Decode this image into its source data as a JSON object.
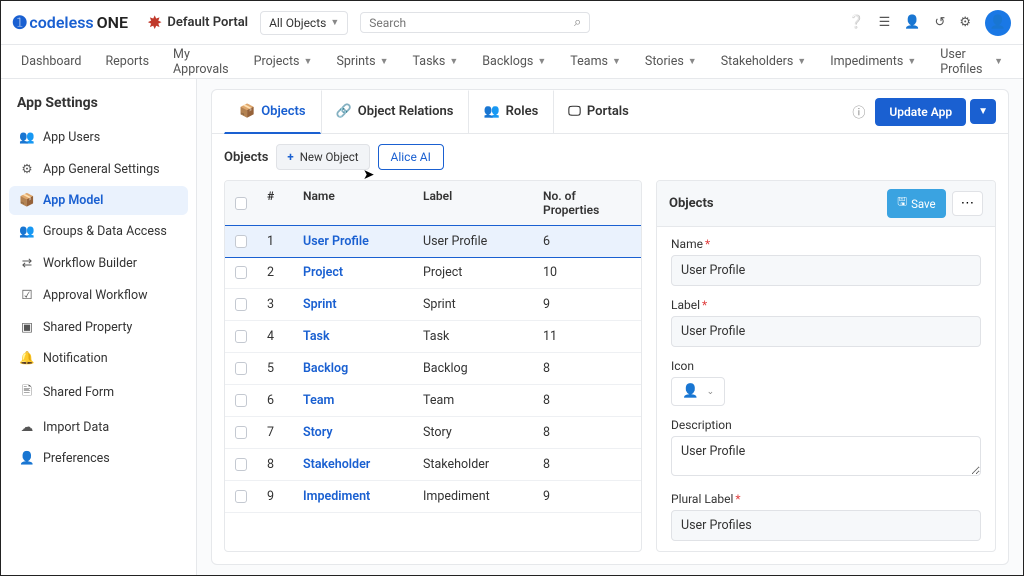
{
  "brand": {
    "part1": "codeless",
    "part2": "ONE"
  },
  "portal": "Default Portal",
  "objectScope": "All Objects",
  "searchPlaceholder": "Search",
  "nav": [
    "Dashboard",
    "Reports",
    "My Approvals",
    "Projects",
    "Sprints",
    "Tasks",
    "Backlogs",
    "Teams",
    "Stories",
    "Stakeholders",
    "Impediments",
    "User Profiles"
  ],
  "navHasCaret": [
    false,
    false,
    false,
    true,
    true,
    true,
    true,
    true,
    true,
    true,
    true,
    true
  ],
  "sidebar": {
    "title": "App Settings",
    "items": [
      {
        "label": "App Users"
      },
      {
        "label": "App General Settings"
      },
      {
        "label": "App Model"
      },
      {
        "label": "Groups & Data Access"
      },
      {
        "label": "Workflow Builder"
      },
      {
        "label": "Approval Workflow"
      },
      {
        "label": "Shared Property"
      },
      {
        "label": "Notification"
      },
      {
        "label": "Shared Form"
      },
      {
        "label": "Import Data"
      },
      {
        "label": "Preferences"
      }
    ],
    "activeIndex": 2
  },
  "tabs": [
    {
      "label": "Objects"
    },
    {
      "label": "Object Relations"
    },
    {
      "label": "Roles"
    },
    {
      "label": "Portals"
    }
  ],
  "updateBtn": "Update App",
  "crumb": "Objects",
  "newObjectBtn": "New Object",
  "aliceBtn": "Alice AI",
  "table": {
    "headers": {
      "num": "#",
      "name": "Name",
      "label": "Label",
      "props": "No. of Properties"
    },
    "rows": [
      {
        "n": "1",
        "name": "User Profile",
        "label": "User Profile",
        "props": "6"
      },
      {
        "n": "2",
        "name": "Project",
        "label": "Project",
        "props": "10"
      },
      {
        "n": "3",
        "name": "Sprint",
        "label": "Sprint",
        "props": "9"
      },
      {
        "n": "4",
        "name": "Task",
        "label": "Task",
        "props": "11"
      },
      {
        "n": "5",
        "name": "Backlog",
        "label": "Backlog",
        "props": "8"
      },
      {
        "n": "6",
        "name": "Team",
        "label": "Team",
        "props": "8"
      },
      {
        "n": "7",
        "name": "Story",
        "label": "Story",
        "props": "8"
      },
      {
        "n": "8",
        "name": "Stakeholder",
        "label": "Stakeholder",
        "props": "8"
      },
      {
        "n": "9",
        "name": "Impediment",
        "label": "Impediment",
        "props": "9"
      }
    ],
    "selectedIndex": 0
  },
  "details": {
    "title": "Objects",
    "save": "Save",
    "fields": {
      "nameLabel": "Name",
      "nameValue": "User Profile",
      "labelLabel": "Label",
      "labelValue": "User Profile",
      "iconLabel": "Icon",
      "descLabel": "Description",
      "descValue": "User Profile",
      "pluralLabel": "Plural Label",
      "pluralValue": "User Profiles"
    }
  }
}
